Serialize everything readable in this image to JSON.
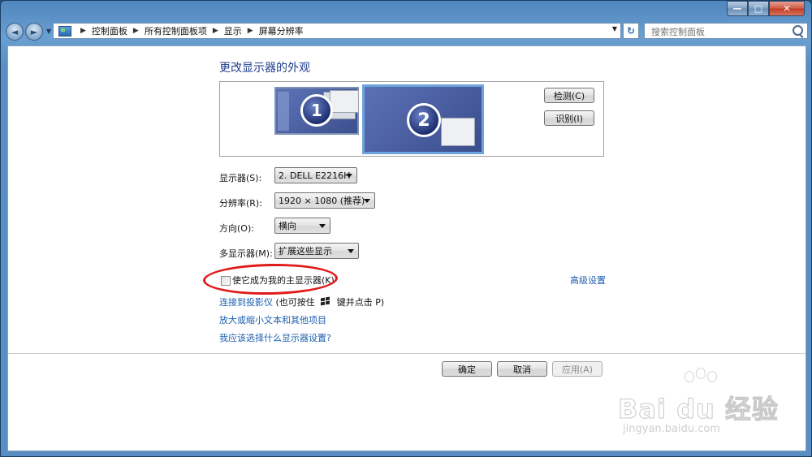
{
  "window": {
    "buttons": {
      "minimize": "—",
      "maximize": "□",
      "close": "✕"
    }
  },
  "address_bar": {
    "back": "◄",
    "forward": "►",
    "breadcrumbs": [
      "控制面板",
      "所有控制面板项",
      "显示",
      "屏幕分辨率"
    ],
    "refresh": "↻",
    "search_placeholder": "搜索控制面板"
  },
  "page": {
    "heading": "更改显示器的外观",
    "monitors": [
      {
        "number": "1"
      },
      {
        "number": "2"
      }
    ],
    "detect_button": "检测(C)",
    "identify_button": "识别(I)",
    "settings": {
      "display_label": "显示器(S):",
      "display_value": "2. DELL E2216H",
      "resolution_label": "分辨率(R):",
      "resolution_value": "1920 × 1080 (推荐)",
      "orientation_label": "方向(O):",
      "orientation_value": "横向",
      "multi_label": "多显示器(M):",
      "multi_value": "扩展这些显示"
    },
    "primary_checkbox": {
      "label": "使它成为我的主显示器(K)",
      "checked": false
    },
    "advanced_link": "高级设置",
    "projector_link": "连接到投影仪",
    "projector_hint_a": "(也可按住",
    "projector_hint_b": "键并点击 P)",
    "text_size_link": "放大或缩小文本和其他项目",
    "which_settings_link": "我应该选择什么显示器设置?",
    "ok_button": "确定",
    "cancel_button": "取消",
    "apply_button": "应用(A)"
  },
  "watermark": {
    "brand": "Bai du 经验",
    "url": "jingyan.baidu.com"
  },
  "colors": {
    "annotation_oval": "#e01b1b",
    "link": "#1c5fb0",
    "heading": "#1e3d8f"
  }
}
